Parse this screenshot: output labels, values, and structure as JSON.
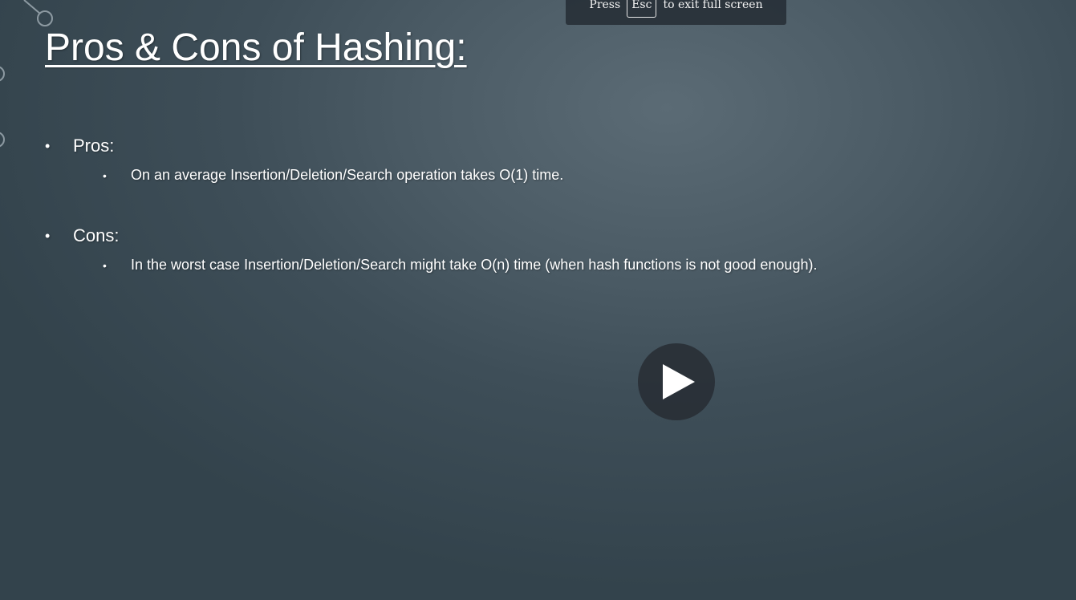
{
  "slide": {
    "title": "Pros & Cons of Hashing:",
    "sections": [
      {
        "heading": "Pros:",
        "items": [
          "On an average Insertion/Deletion/Search operation takes O(1) time."
        ]
      },
      {
        "heading": "Cons:",
        "items": [
          "In the worst case Insertion/Deletion/Search might take O(n) time (when hash functions is not good enough)."
        ]
      }
    ],
    "bullet_glyph": "•"
  },
  "fullscreen_notice": {
    "prefix": "Press",
    "key": "Esc",
    "suffix": "to exit full screen"
  },
  "player": {
    "play_icon": "play-icon"
  },
  "colors": {
    "background_center": "#5b6b75",
    "background_edge": "#33434c",
    "text": "#ffffff",
    "overlay": "#262e36"
  }
}
